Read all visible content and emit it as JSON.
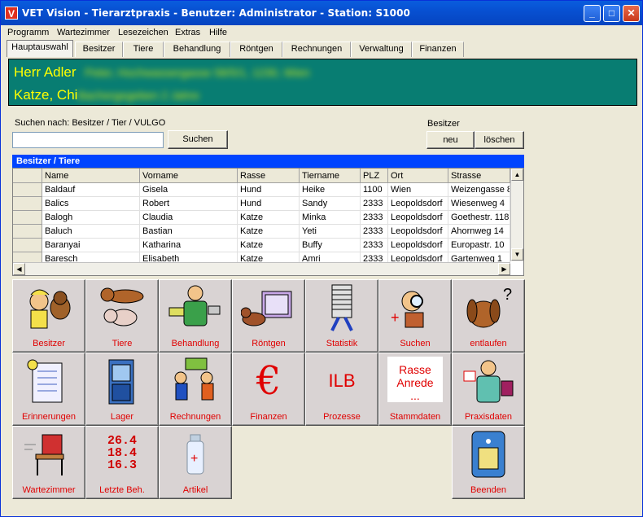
{
  "window": {
    "title": "VET Vision - Tierarztpraxis - Benutzer: Administrator - Station: S1000"
  },
  "menu": [
    "Programm",
    "Wartezimmer",
    "Lesezeichen",
    "Extras",
    "Hilfe"
  ],
  "tabs": [
    "Hauptauswahl",
    "Besitzer",
    "Tiere",
    "Behandlung",
    "Röntgen",
    "Rechnungen",
    "Verwaltung",
    "Finanzen"
  ],
  "header": {
    "owner_name": "Herr Adler",
    "owner_details": "Peter, Hochwassergasse 58/5/1, 1230, Wien",
    "animal_name": "Katze, Chi",
    "animal_details": "Bachergegeben 2 Jahre"
  },
  "search": {
    "label": "Suchen nach: Besitzer / Tier / VULGO",
    "value": "",
    "button": "Suchen"
  },
  "besitzer": {
    "label": "Besitzer",
    "new_button": "neu",
    "delete_button": "löschen"
  },
  "grid": {
    "title": "Besitzer / Tiere",
    "columns": [
      "Name",
      "Vorname",
      "Rasse",
      "Tiername",
      "PLZ",
      "Ort",
      "Strasse"
    ],
    "rows": [
      [
        "Baldauf",
        "Gisela",
        "Hund",
        "Heike",
        "1100",
        "Wien",
        "Weizengasse 8"
      ],
      [
        "Balics",
        "Robert",
        "Hund",
        "Sandy",
        "2333",
        "Leopoldsdorf",
        "Wiesenweg 4"
      ],
      [
        "Balogh",
        "Claudia",
        "Katze",
        "Minka",
        "2333",
        "Leopoldsdorf",
        "Goethestr. 118"
      ],
      [
        "Baluch",
        "Bastian",
        "Katze",
        "Yeti",
        "2333",
        "Leopoldsdorf",
        "Ahornweg 14"
      ],
      [
        "Baranyai",
        "Katharina",
        "Katze",
        "Buffy",
        "2333",
        "Leopoldsdorf",
        "Europastr. 10"
      ],
      [
        "Baresch",
        "Elisabeth",
        "Katze",
        "Amri",
        "2333",
        "Leopoldsdorf",
        "Gartenweg 1"
      ]
    ]
  },
  "tiles": [
    {
      "label": "Besitzer",
      "icon": "owner-with-dog-icon"
    },
    {
      "label": "Tiere",
      "icon": "cat-dog-icon"
    },
    {
      "label": "Behandlung",
      "icon": "vet-doctor-icon"
    },
    {
      "label": "Röntgen",
      "icon": "xray-dog-icon"
    },
    {
      "label": "Statistik",
      "icon": "paper-stack-icon"
    },
    {
      "label": "Suchen",
      "icon": "magnifier-man-icon"
    },
    {
      "label": "entlaufen",
      "icon": "lost-dog-icon"
    },
    {
      "label": "Erinnerungen",
      "icon": "reminder-list-icon"
    },
    {
      "label": "Lager",
      "icon": "storage-cabinet-icon"
    },
    {
      "label": "Rechnungen",
      "icon": "money-people-icon"
    },
    {
      "label": "Finanzen",
      "icon": "euro-icon",
      "glyph": "€"
    },
    {
      "label": "Prozesse",
      "icon": "ilb-icon",
      "glyph": "ILB"
    },
    {
      "label": "Stammdaten",
      "icon": "rasse-anrede-icon",
      "glyph_line1": "Rasse",
      "glyph_line2": "Anrede",
      "glyph_line3": "..."
    },
    {
      "label": "Praxisdaten",
      "icon": "vet-practice-icon"
    },
    {
      "label": "Wartezimmer",
      "icon": "waiting-chair-icon"
    },
    {
      "label": "Letzte Beh.",
      "icon": "dates-icon",
      "glyph_line1": "26.4",
      "glyph_line2": "18.4",
      "glyph_line3": "16.3"
    },
    {
      "label": "Artikel",
      "icon": "medicine-bottle-icon"
    },
    {
      "label": "Beenden",
      "icon": "exit-door-icon"
    }
  ],
  "colors": {
    "header_bg": "#087d72",
    "header_text": "#ffff00",
    "tile_label": "#e00000",
    "grid_title_bg": "#0044ff"
  }
}
